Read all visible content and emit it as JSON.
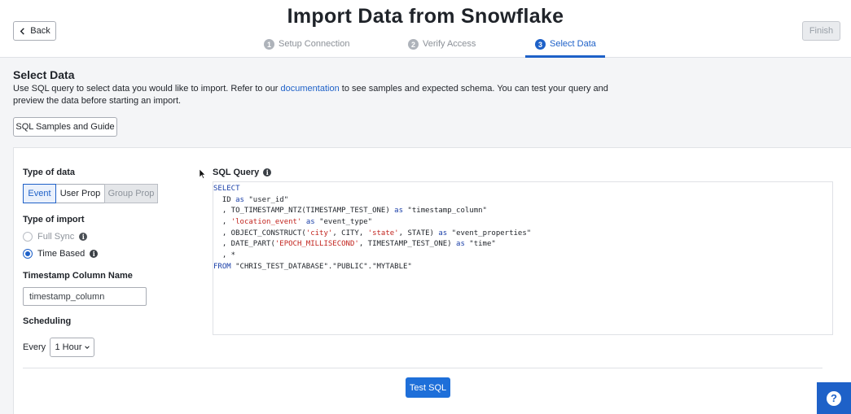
{
  "header": {
    "back_label": "Back",
    "title": "Import Data from Snowflake",
    "finish_label": "Finish",
    "steps": [
      {
        "number": "1",
        "label": "Setup Connection",
        "active": false
      },
      {
        "number": "2",
        "label": "Verify Access",
        "active": false
      },
      {
        "number": "3",
        "label": "Select Data",
        "active": true
      }
    ]
  },
  "intro": {
    "title": "Select Data",
    "desc_before": "Use SQL query to select data you would like to import. Refer to our ",
    "desc_link": "documentation",
    "desc_after": " to see samples and expected schema. You can test your query and preview the data before starting an import.",
    "samples_button": "SQL Samples and Guide"
  },
  "form": {
    "type_of_data_label": "Type of data",
    "data_types": [
      "Event",
      "User Prop",
      "Group Prop"
    ],
    "type_of_import_label": "Type of import",
    "import_types": [
      "Full Sync",
      "Time Based"
    ],
    "timestamp_label": "Timestamp Column Name",
    "timestamp_value": "timestamp_column",
    "scheduling_label": "Scheduling",
    "every_label": "Every",
    "interval_value": "1 Hour"
  },
  "sql": {
    "label": "SQL Query",
    "lines": [
      [
        {
          "t": "SELECT",
          "c": "kw"
        }
      ],
      [
        {
          "t": "  ID ",
          "c": ""
        },
        {
          "t": "as",
          "c": "kw"
        },
        {
          "t": " \"user_id\"",
          "c": ""
        }
      ],
      [
        {
          "t": "  , TO_TIMESTAMP_NTZ(TIMESTAMP_TEST_ONE) ",
          "c": ""
        },
        {
          "t": "as",
          "c": "kw"
        },
        {
          "t": " \"timestamp_column\"",
          "c": ""
        }
      ],
      [
        {
          "t": "  , ",
          "c": ""
        },
        {
          "t": "'location_event'",
          "c": "str"
        },
        {
          "t": " ",
          "c": ""
        },
        {
          "t": "as",
          "c": "kw"
        },
        {
          "t": " \"event_type\"",
          "c": ""
        }
      ],
      [
        {
          "t": "  , OBJECT_CONSTRUCT(",
          "c": ""
        },
        {
          "t": "'city'",
          "c": "str"
        },
        {
          "t": ", CITY, ",
          "c": ""
        },
        {
          "t": "'state'",
          "c": "str"
        },
        {
          "t": ", STATE) ",
          "c": ""
        },
        {
          "t": "as",
          "c": "kw"
        },
        {
          "t": " \"event_properties\"",
          "c": ""
        }
      ],
      [
        {
          "t": "  , DATE_PART(",
          "c": ""
        },
        {
          "t": "'EPOCH_MILLISECOND'",
          "c": "str"
        },
        {
          "t": ", TIMESTAMP_TEST_ONE) ",
          "c": ""
        },
        {
          "t": "as",
          "c": "kw"
        },
        {
          "t": " \"time\"",
          "c": ""
        }
      ],
      [
        {
          "t": "  , *",
          "c": ""
        }
      ],
      [
        {
          "t": "FROM",
          "c": "kw"
        },
        {
          "t": " \"CHRIS_TEST_DATABASE\".\"PUBLIC\".\"MYTABLE\"",
          "c": ""
        }
      ]
    ]
  },
  "actions": {
    "test_sql": "Test SQL"
  },
  "icons": {
    "back": "chevron-left-icon",
    "info": "info-icon",
    "help": "help-icon",
    "dropdown": "chevron-down-icon"
  },
  "colors": {
    "accent": "#1e61c8",
    "keyword": "#1a3fa8",
    "string": "#c2251f"
  }
}
